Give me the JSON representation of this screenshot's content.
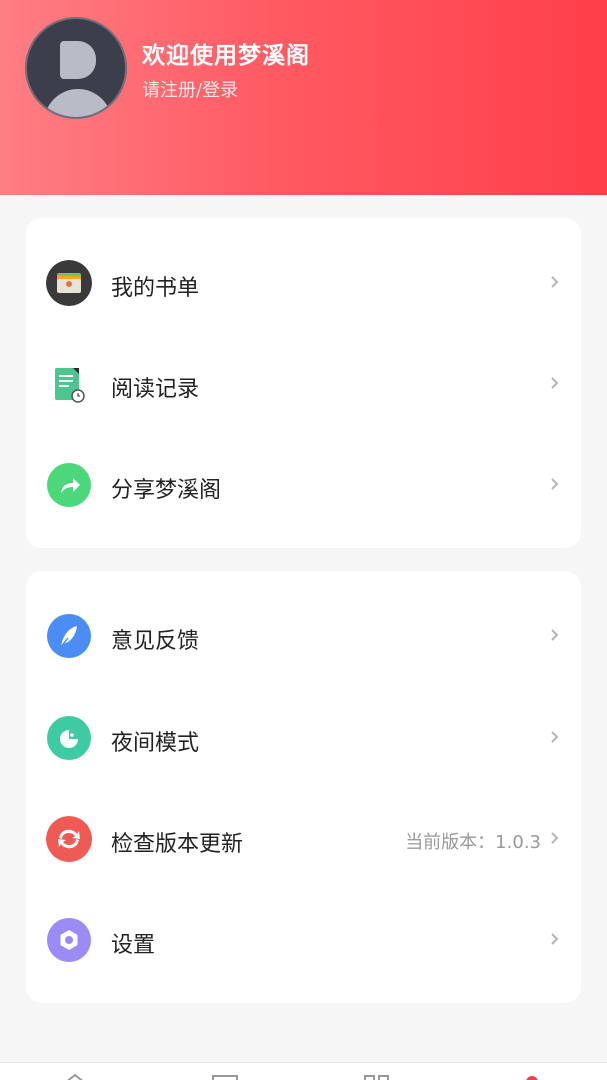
{
  "header": {
    "welcome": "欢迎使用梦溪阁",
    "login": "请注册/登录"
  },
  "menu1": [
    {
      "label": "我的书单",
      "icon": "wallet-icon"
    },
    {
      "label": "阅读记录",
      "icon": "reading-record-icon"
    },
    {
      "label": "分享梦溪阁",
      "icon": "share-icon"
    }
  ],
  "menu2": [
    {
      "label": "意见反馈",
      "icon": "feather-icon"
    },
    {
      "label": "夜间模式",
      "icon": "night-mode-icon"
    },
    {
      "label": "检查版本更新",
      "icon": "refresh-icon",
      "extra": "当前版本：1.0.3"
    },
    {
      "label": "设置",
      "icon": "gear-icon"
    }
  ],
  "colors": {
    "accent": "#ff3f4a",
    "wallet": "#3a3a3a",
    "record": "#4cc58e",
    "share": "#4bd87a",
    "feedback": "#4c8cf5",
    "night": "#3ecba3",
    "update": "#f05a55",
    "settings": "#9b8cf5"
  }
}
